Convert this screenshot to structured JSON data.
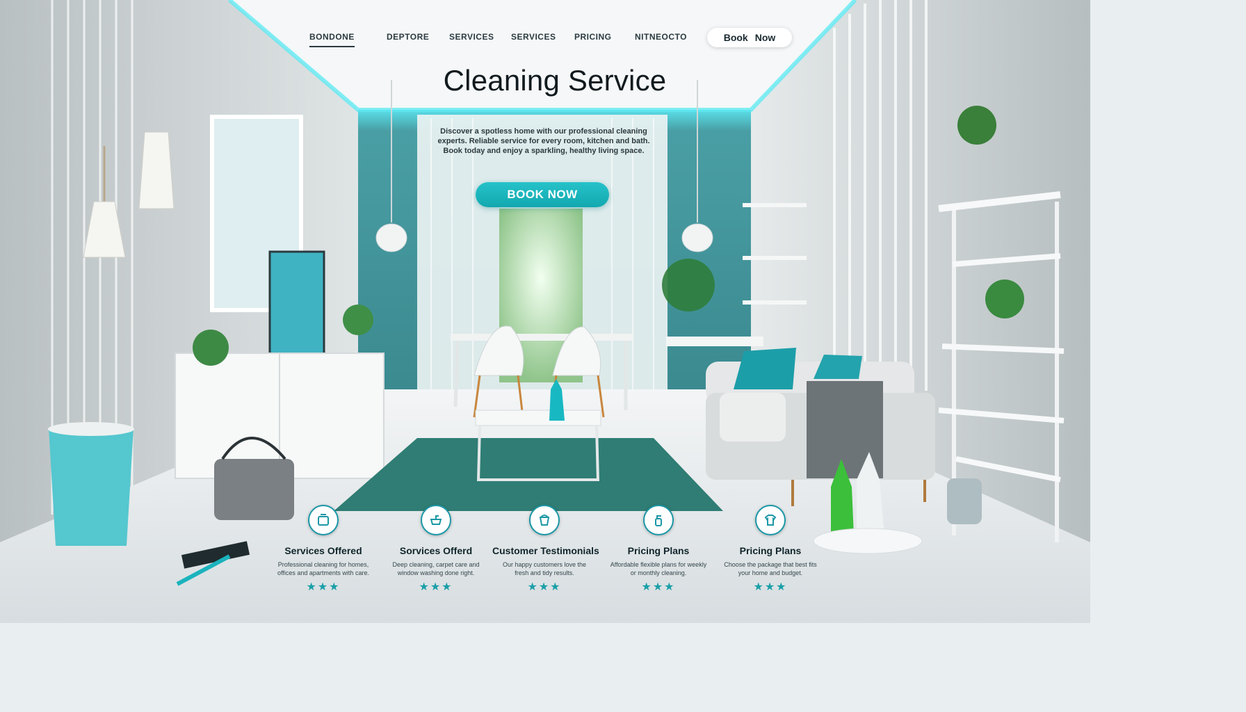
{
  "nav": {
    "items": [
      "BONDONE",
      "DEPTORE",
      "SERVICES",
      "SERVICES",
      "PRICING",
      "NITNEOCTO"
    ],
    "cta": {
      "part1": "Book",
      "part2": "Now"
    }
  },
  "hero": {
    "title": "Cleaning Service",
    "description": "Discover a spotless home with our professional cleaning experts. Reliable service for every room, kitchen and bath. Book today and enjoy a sparkling, healthy living space.",
    "cta": "BOOK NOW"
  },
  "features": [
    {
      "title": "Services Offered",
      "text": "Professional cleaning for homes, offices and apartments with care.",
      "stars": "★★★"
    },
    {
      "title": "Sorvices Offerd",
      "text": "Deep cleaning, carpet care and window washing done right.",
      "stars": "★★★"
    },
    {
      "title": "Customer Testimonials",
      "text": "Our happy customers love the fresh and tidy results.",
      "stars": "★★★"
    },
    {
      "title": "Pricing Plans",
      "text": "Affordable flexible plans for weekly or monthly cleaning.",
      "stars": "★★★"
    },
    {
      "title": "Pricing Plans",
      "text": "Choose the package that best fits your home and budget.",
      "stars": "★★★"
    }
  ],
  "colors": {
    "accent": "#1aa9b2",
    "accent_glow": "#58e4ee",
    "rug": "#2f7d74",
    "text_dark": "#111a1e"
  }
}
